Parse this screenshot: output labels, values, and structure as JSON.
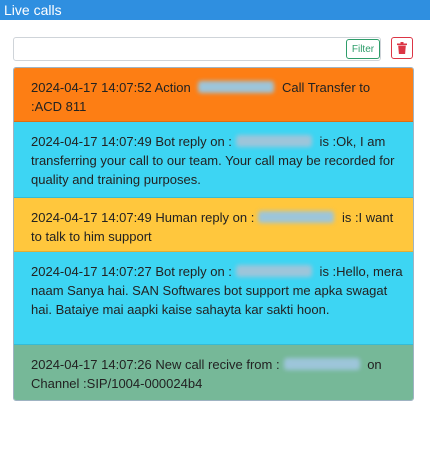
{
  "window": {
    "title": "Live calls"
  },
  "toolbar": {
    "search_placeholder": "",
    "filter_label": "Filter"
  },
  "colors": {
    "title_bar": "#2f8fe0",
    "action": "#fd7e14",
    "bot_reply": "#3dd5f3",
    "human_reply": "#ffc73d",
    "new_call": "#76b898"
  },
  "messages": [
    {
      "type": "action",
      "pre": "2024-04-17 14:07:52 Action ",
      "post": " Call Transfer to :ACD 811"
    },
    {
      "type": "bot_reply",
      "pre": "2024-04-17 14:07:49 Bot reply on :",
      "post": " is :Ok, I am transferring your call to our team. Your call may be recorded for quality and training purposes."
    },
    {
      "type": "human_reply",
      "pre": "2024-04-17 14:07:49 Human reply on :",
      "post": " is :I want to talk to him support"
    },
    {
      "type": "bot_reply",
      "pre": "2024-04-17 14:07:27 Bot reply on :",
      "post": " is :Hello, mera naam Sanya hai. SAN Softwares bot support me apka swagat hai. Bataiye mai aapki kaise sahayta kar sakti hoon."
    },
    {
      "type": "new_call",
      "pre": "2024-04-17 14:07:26 New call recive from :",
      "post": " on Channel :SIP/1004-000024b4"
    }
  ]
}
